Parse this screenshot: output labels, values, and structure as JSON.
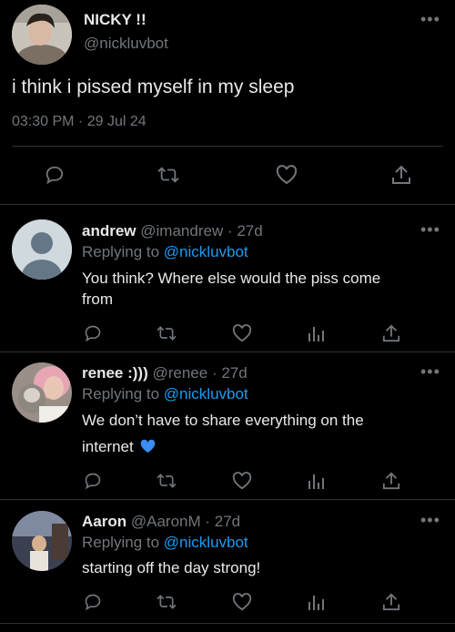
{
  "main_tweet": {
    "display_name": "NICKY !!",
    "handle": "@nickluvbot",
    "text": "i think i pissed myself in my sleep",
    "timestamp": "03:30 PM · 29 Jul 24"
  },
  "replies": [
    {
      "display_name": "andrew",
      "handle": "@imandrew",
      "age": "· 27d",
      "replying_prefix": "Replying to",
      "replying_to": "@nickluvbot",
      "text_line1": "You think? Where else would the piss come",
      "text_line2": "from",
      "avatar": "default-avatar-icon"
    },
    {
      "display_name": "renee :)))",
      "handle": "@renee",
      "age": "· 27d",
      "replying_prefix": "Replying to",
      "replying_to": "@nickluvbot",
      "text_line1": "We don’t have to share everything on the",
      "text_line2": "internet",
      "emoji": "blue-heart-icon"
    },
    {
      "display_name": "Aaron",
      "handle": "@AaronM",
      "age": "· 27d",
      "replying_prefix": "Replying to",
      "replying_to": "@nickluvbot",
      "text_line1": "starting off the day strong!"
    }
  ],
  "icons": [
    "reply-icon",
    "retweet-icon",
    "like-icon",
    "views-icon",
    "share-icon",
    "more-icon"
  ],
  "colors": {
    "background": "#000000",
    "text": "#e7e9ea",
    "muted": "#71767b",
    "link": "#1d9bf0",
    "divider": "#2f3336"
  }
}
